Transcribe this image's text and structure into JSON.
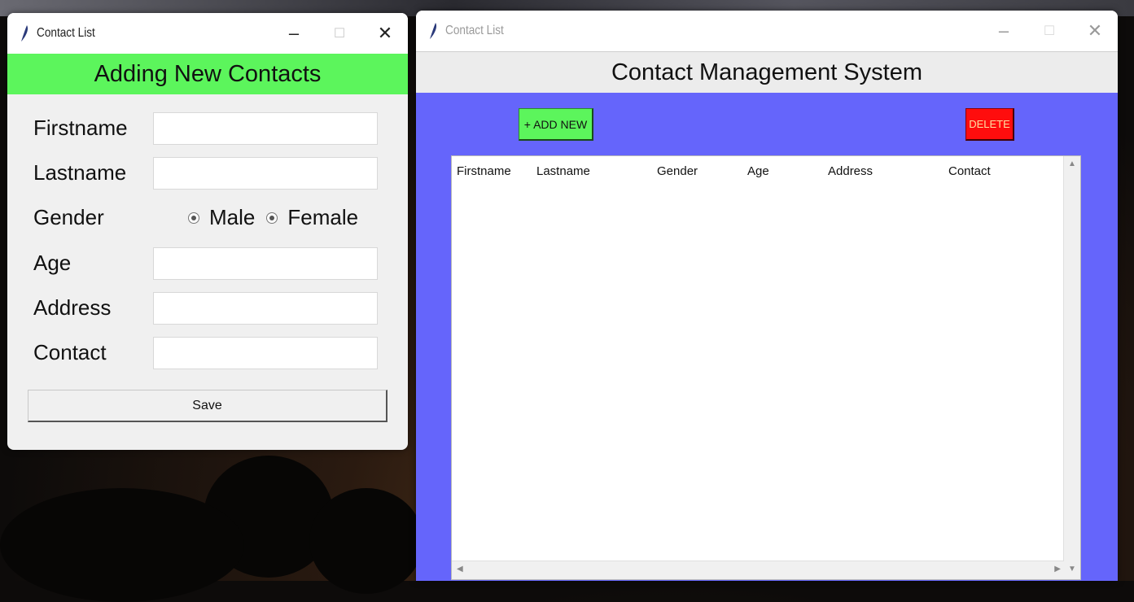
{
  "left_window": {
    "title": "Contact List",
    "controls": {
      "minimize": "–",
      "maximize": "☐",
      "close": "✕"
    },
    "header": "Adding New Contacts",
    "fields": {
      "firstname": {
        "label": "Firstname",
        "value": ""
      },
      "lastname": {
        "label": "Lastname",
        "value": ""
      },
      "gender": {
        "label": "Gender",
        "options": [
          "Male",
          "Female"
        ]
      },
      "age": {
        "label": "Age",
        "value": ""
      },
      "address": {
        "label": "Address",
        "value": ""
      },
      "contact": {
        "label": "Contact",
        "value": ""
      }
    },
    "save_label": "Save"
  },
  "right_window": {
    "title": "Contact List",
    "controls": {
      "minimize": "–",
      "maximize": "☐",
      "close": "✕"
    },
    "header": "Contact Management System",
    "add_label": "+ ADD NEW",
    "delete_label": "DELETE",
    "table": {
      "columns": [
        "Firstname",
        "Lastname",
        "Gender",
        "Age",
        "Address",
        "Contact"
      ],
      "rows": []
    }
  },
  "colors": {
    "header_green": "#5cf55c",
    "panel_blue": "#6565fb",
    "delete_red": "#ff0d0d"
  },
  "icons": [
    "feather-icon",
    "minimize-icon",
    "maximize-icon",
    "close-icon"
  ]
}
